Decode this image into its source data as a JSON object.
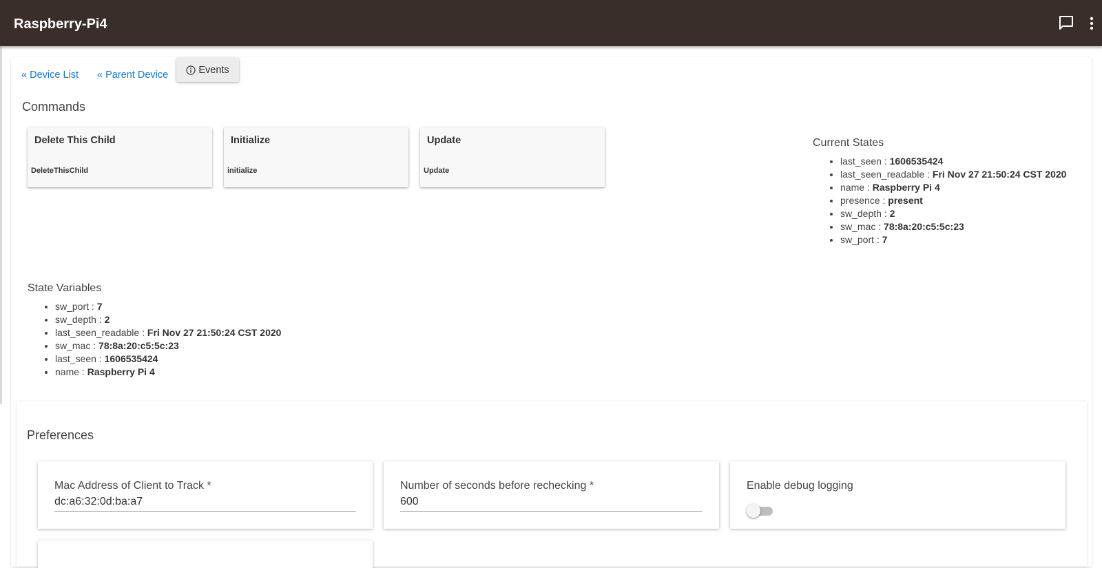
{
  "header": {
    "title": "Raspberry-Pi4",
    "chat_icon": "chat-bubble-icon",
    "menu_icon": "more-vert-icon",
    "background_color": "#3a2e2b"
  },
  "nav": {
    "device_list": "« Device List",
    "parent_device": "« Parent Device",
    "events": "Events",
    "events_icon": "info-circle-icon",
    "link_color": "#1976c9"
  },
  "commands": {
    "title": "Commands",
    "items": [
      {
        "label": "Delete This Child",
        "name": "DeleteThisChild"
      },
      {
        "label": "Initialize",
        "name": "initialize"
      },
      {
        "label": "Update",
        "name": "Update"
      }
    ]
  },
  "current_states": {
    "title": "Current States",
    "items": [
      {
        "key": "last_seen",
        "value": "1606535424"
      },
      {
        "key": "last_seen_readable",
        "value": "Fri Nov 27 21:50:24 CST 2020"
      },
      {
        "key": "name",
        "value": "Raspberry Pi 4"
      },
      {
        "key": "presence",
        "value": "present"
      },
      {
        "key": "sw_depth",
        "value": "2"
      },
      {
        "key": "sw_mac",
        "value": "78:8a:20:c5:5c:23"
      },
      {
        "key": "sw_port",
        "value": "7"
      }
    ]
  },
  "state_variables": {
    "title": "State Variables",
    "items": [
      {
        "key": "sw_port",
        "value": "7"
      },
      {
        "key": "sw_depth",
        "value": "2"
      },
      {
        "key": "last_seen_readable",
        "value": "Fri Nov 27 21:50:24 CST 2020"
      },
      {
        "key": "sw_mac",
        "value": "78:8a:20:c5:5c:23"
      },
      {
        "key": "last_seen",
        "value": "1606535424"
      },
      {
        "key": "name",
        "value": "Raspberry Pi 4"
      }
    ]
  },
  "preferences": {
    "title": "Preferences",
    "mac_address": {
      "label": "Mac Address of Client to Track *",
      "value": "dc:a6:32:0d:ba:a7"
    },
    "recheck_seconds": {
      "label": "Number of seconds before rechecking *",
      "value": "600"
    },
    "debug_logging": {
      "label": "Enable debug logging",
      "enabled": false
    }
  }
}
